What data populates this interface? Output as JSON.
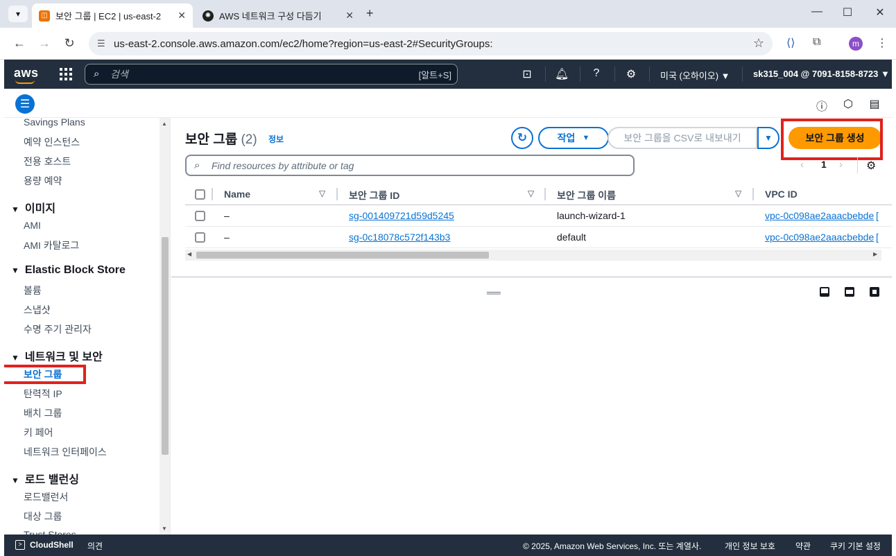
{
  "browser": {
    "tabs": [
      {
        "title": "보안 그룹 | EC2 | us-east-2",
        "active": true
      },
      {
        "title": "AWS 네트워크 구성 다듬기",
        "active": false
      }
    ],
    "new_tab": "+",
    "url": "us-east-2.console.aws.amazon.com/ec2/home?region=us-east-2#SecurityGroups:",
    "profile_initial": "m"
  },
  "aws_header": {
    "logo": "aws",
    "search_placeholder": "검색",
    "search_shortcut": "[알트+S]",
    "region": "미국 (오하이오) ▼",
    "account": "sk315_004 @ 7091-8158-8723 ▼"
  },
  "sidebar": {
    "items_top": [
      "Savings Plans",
      "예약 인스턴스",
      "전용 호스트",
      "용량 예약"
    ],
    "sections": [
      {
        "title": "이미지",
        "items": [
          "AMI",
          "AMI 카탈로그"
        ]
      },
      {
        "title": "Elastic Block Store",
        "items": [
          "볼륨",
          "스냅샷",
          "수명 주기 관리자"
        ]
      },
      {
        "title": "네트워크 및 보안",
        "items": [
          "보안 그룹",
          "탄력적 IP",
          "배치 그룹",
          "키 페어",
          "네트워크 인터페이스"
        ]
      },
      {
        "title": "로드 밸런싱",
        "items": [
          "로드밸런서",
          "대상 그룹",
          "Trust Stores"
        ]
      }
    ],
    "active_item": "보안 그룹"
  },
  "main": {
    "title": "보안 그룹",
    "count": "(2)",
    "info": "정보",
    "actions_label": "작업",
    "csv_label": "보안 그룹을 CSV로 내보내기",
    "create_label": "보안 그룹 생성",
    "filter_placeholder": "Find resources by attribute or tag",
    "page_number": "1",
    "columns": [
      "Name",
      "보안 그룹 ID",
      "보안 그룹 이름",
      "VPC ID"
    ],
    "rows": [
      {
        "name": "–",
        "sg_id": "sg-001409721d59d5245",
        "sg_name": "launch-wizard-1",
        "vpc_id": "vpc-0c098ae2aaacbebde"
      },
      {
        "name": "–",
        "sg_id": "sg-0c18078c572f143b3",
        "sg_name": "default",
        "vpc_id": "vpc-0c098ae2aaacbebde"
      }
    ]
  },
  "footer": {
    "cloudshell": "CloudShell",
    "feedback": "의견",
    "copyright": "© 2025, Amazon Web Services, Inc. 또는 계열사.",
    "privacy": "개인 정보 보호",
    "terms": "약관",
    "cookies": "쿠키 기본 설정"
  },
  "colors": {
    "aws_dark": "#232f3e",
    "accent_blue": "#0972d3",
    "orange": "#ff9900",
    "highlight_red": "#e0221e"
  }
}
